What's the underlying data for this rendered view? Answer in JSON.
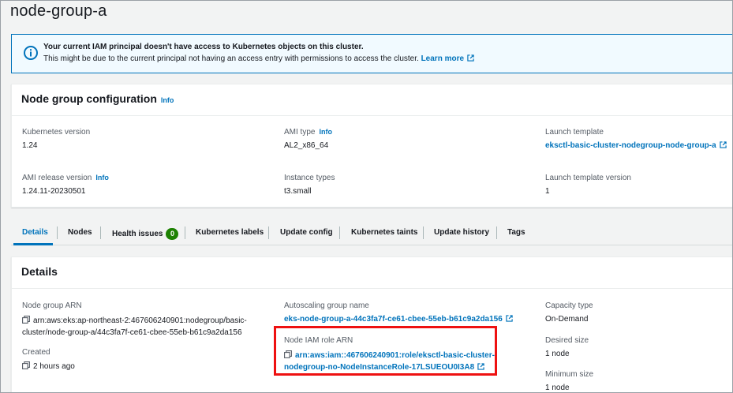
{
  "page_title": "node-group-a",
  "alert": {
    "title": "Your current IAM principal doesn't have access to Kubernetes objects on this cluster.",
    "body": "This might be due to the current principal not having an access entry with permissions to access the cluster.",
    "link": "Learn more",
    "color": "#0073bb"
  },
  "config": {
    "heading": "Node group configuration",
    "info": "Info",
    "k8s_version_label": "Kubernetes version",
    "k8s_version_value": "1.24",
    "ami_type_label": "AMI type",
    "ami_type_info": "Info",
    "ami_type_value": "AL2_x86_64",
    "launch_template_label": "Launch template",
    "launch_template_value": "eksctl-basic-cluster-nodegroup-node-group-a",
    "ami_release_label": "AMI release version",
    "ami_release_info": "Info",
    "ami_release_value": "1.24.11-20230501",
    "instance_types_label": "Instance types",
    "instance_types_value": "t3.small",
    "launch_template_version_label": "Launch template version",
    "launch_template_version_value": "1"
  },
  "tabs": [
    {
      "label": "Details",
      "active": true
    },
    {
      "label": "Nodes"
    },
    {
      "label": "Health issues",
      "badge": "0"
    },
    {
      "label": "Kubernetes labels"
    },
    {
      "label": "Update config"
    },
    {
      "label": "Kubernetes taints"
    },
    {
      "label": "Update history"
    },
    {
      "label": "Tags"
    }
  ],
  "details": {
    "heading": "Details",
    "arn_label": "Node group ARN",
    "arn_line1": "arn:aws:eks:ap-northeast-2:467606240901:nodegroup/basic-",
    "arn_line2": "cluster/node-group-a/44c3fa7f-ce61-cbee-55eb-b61c9a2da156",
    "created_label": "Created",
    "created_value": "2 hours ago",
    "asg_label": "Autoscaling group name",
    "asg_value": "eks-node-group-a-44c3fa7f-ce61-cbee-55eb-b61c9a2da156",
    "role_label": "Node IAM role ARN",
    "role_line1": "arn:aws:iam::467606240901:role/eksctl-basic-cluster-",
    "role_line2": "nodegroup-no-NodeInstanceRole-17LSUEOU0I3A8",
    "capacity_label": "Capacity type",
    "capacity_value": "On-Demand",
    "desired_label": "Desired size",
    "desired_value": "1 node",
    "min_label": "Minimum size",
    "min_value": "1 node"
  },
  "colors": {
    "link": "#0073bb",
    "badge": "#1d8102",
    "highlight": "#e11111"
  }
}
